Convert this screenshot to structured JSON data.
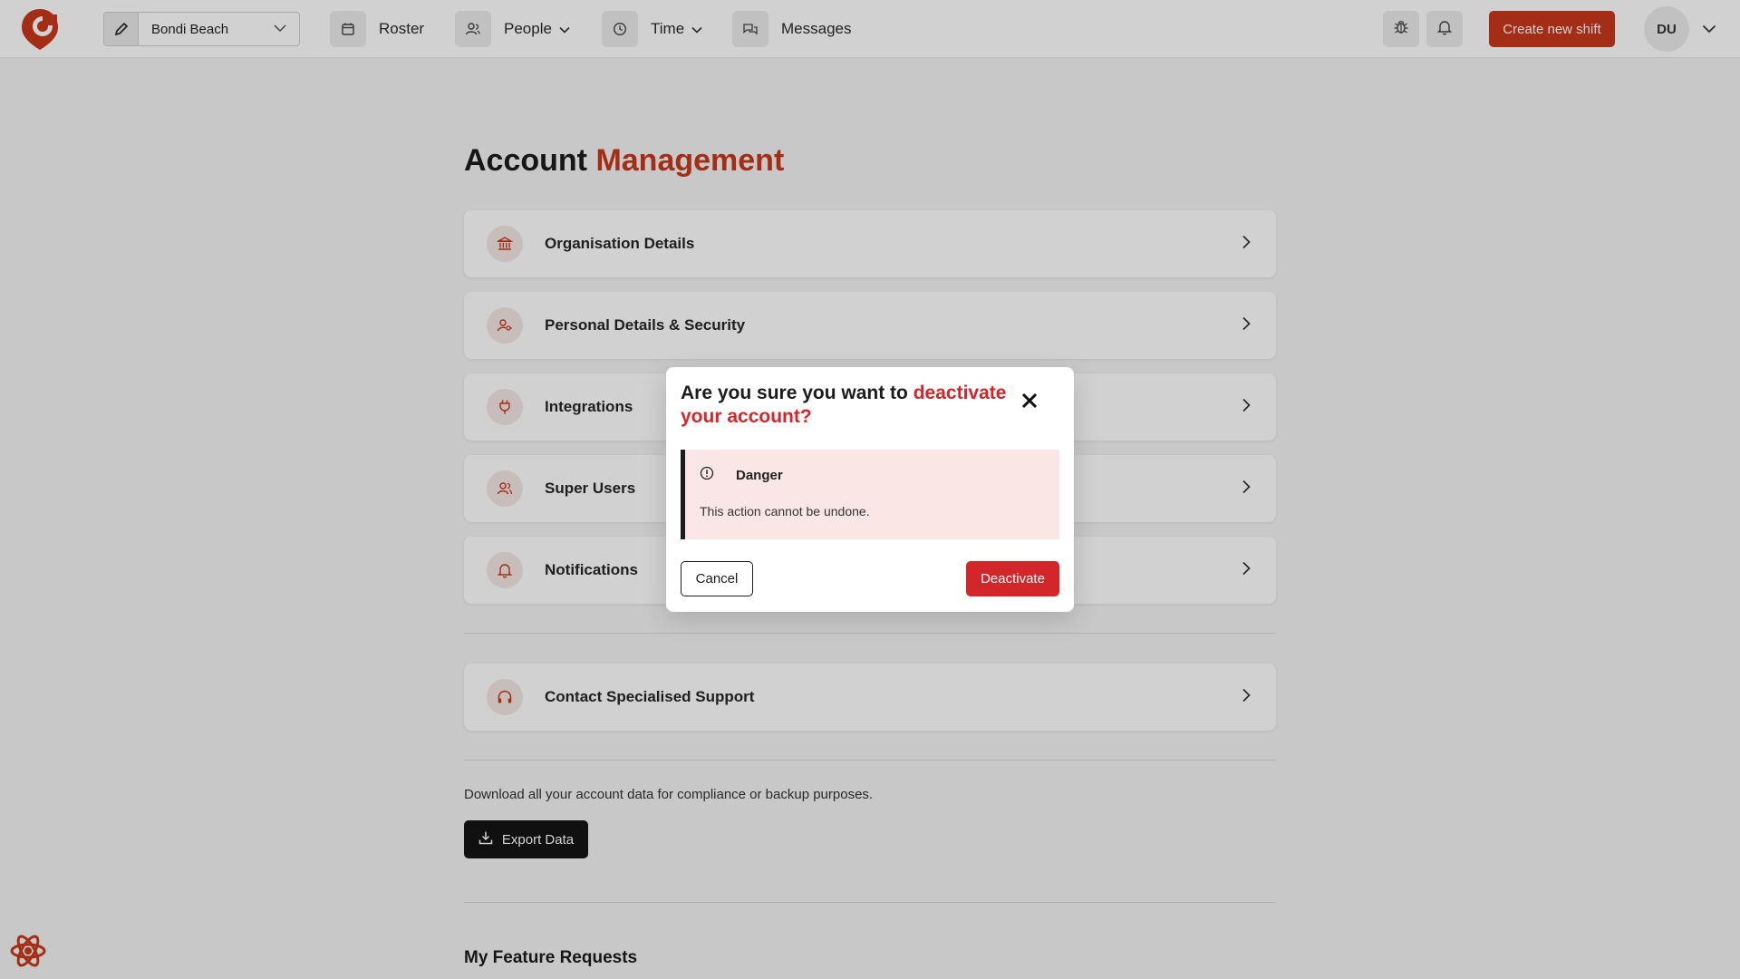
{
  "header": {
    "location": "Bondi Beach",
    "nav": [
      {
        "label": "Roster",
        "icon": "calendar-icon"
      },
      {
        "label": "People",
        "icon": "users-icon"
      },
      {
        "label": "Time",
        "icon": "clock-icon"
      },
      {
        "label": "Messages",
        "icon": "chat-icon"
      }
    ],
    "create_label": "Create new shift",
    "avatar_initials": "DU"
  },
  "page": {
    "title_plain": "Account",
    "title_accent": "Management",
    "cards": [
      {
        "label": "Organisation Details",
        "icon": "bank-icon"
      },
      {
        "label": "Personal Details & Security",
        "icon": "user-key-icon"
      },
      {
        "label": "Integrations",
        "icon": "plug-icon"
      },
      {
        "label": "Super Users",
        "icon": "super-users-icon"
      },
      {
        "label": "Notifications",
        "icon": "bell-icon"
      }
    ],
    "support_label": "Contact Specialised Support",
    "export_text": "Download all your account data for compliance or backup purposes.",
    "export_label": "Export Data",
    "feature_title": "My Feature Requests"
  },
  "modal": {
    "title_plain": "Are you sure you want to ",
    "title_accent": "deactivate your account?",
    "alert_title": "Danger",
    "alert_body": "This action cannot be undone.",
    "cancel_label": "Cancel",
    "confirm_label": "Deactivate"
  },
  "colors": {
    "brand": "#c7381a",
    "danger": "#d3262a",
    "alert_bg": "#fbe6e6"
  }
}
